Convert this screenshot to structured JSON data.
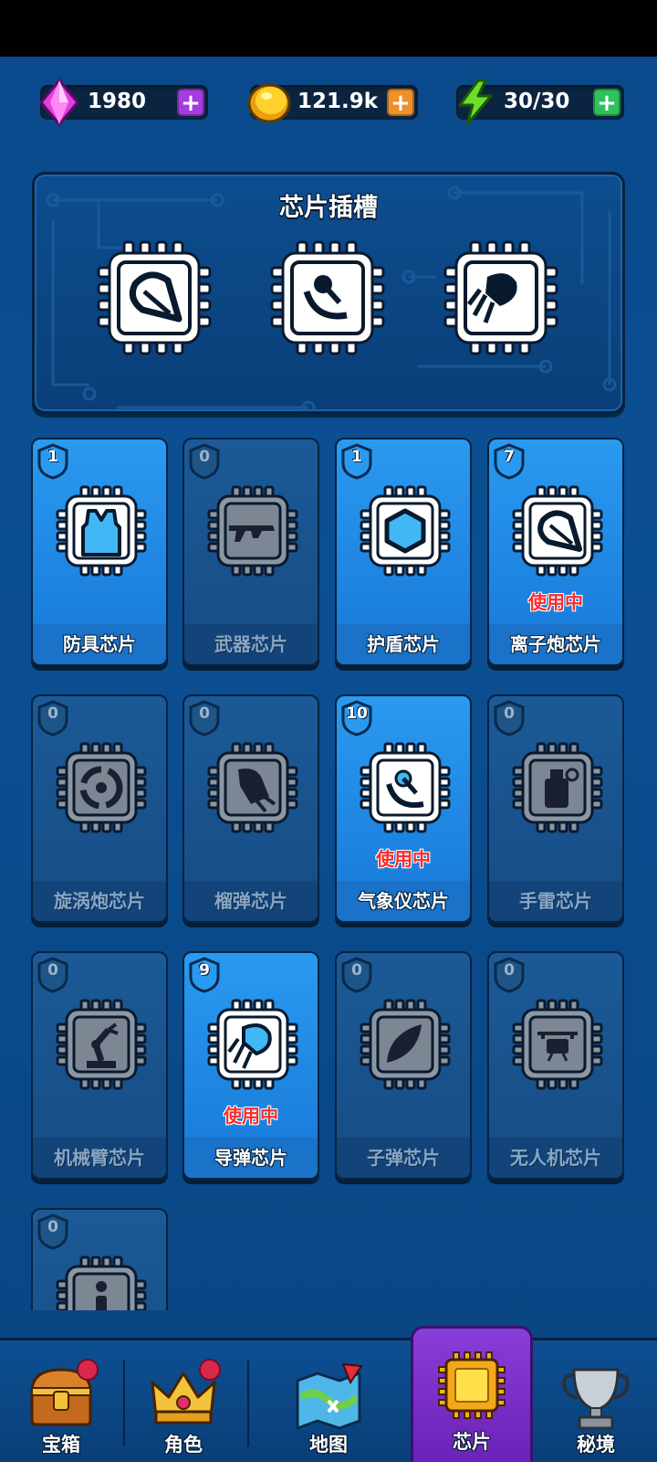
{
  "resources": [
    {
      "name": "gems",
      "value": "1980",
      "icon": "gem-icon",
      "plus_color": "#a63be0"
    },
    {
      "name": "coins",
      "value": "121.9k",
      "icon": "coin-icon",
      "plus_color": "#f0902a"
    },
    {
      "name": "energy",
      "value": "30/30",
      "icon": "lightning-icon",
      "plus_color": "#2ec25a"
    }
  ],
  "slot_panel": {
    "title": "芯片插槽",
    "slots": [
      "ion-cannon-chip-icon",
      "weather-chip-icon",
      "missile-chip-icon"
    ]
  },
  "cards": [
    {
      "level": "1",
      "label": "防具芯片",
      "active": true,
      "in_use": "",
      "icon": "vest-icon"
    },
    {
      "level": "0",
      "label": "武器芯片",
      "active": false,
      "in_use": "",
      "icon": "rifle-icon"
    },
    {
      "level": "1",
      "label": "护盾芯片",
      "active": true,
      "in_use": "",
      "icon": "hexagon-shield-icon"
    },
    {
      "level": "7",
      "label": "离子炮芯片",
      "active": true,
      "in_use": "使用中",
      "icon": "ion-cannon-icon"
    },
    {
      "level": "0",
      "label": "旋涡炮芯片",
      "active": false,
      "in_use": "",
      "icon": "vortex-icon"
    },
    {
      "level": "0",
      "label": "榴弹芯片",
      "active": false,
      "in_use": "",
      "icon": "grenade-launcher-icon"
    },
    {
      "level": "10",
      "label": "气象仪芯片",
      "active": true,
      "in_use": "使用中",
      "icon": "weather-probe-icon"
    },
    {
      "level": "0",
      "label": "手雷芯片",
      "active": false,
      "in_use": "",
      "icon": "hand-grenade-icon"
    },
    {
      "level": "0",
      "label": "机械臂芯片",
      "active": false,
      "in_use": "",
      "icon": "robot-arm-icon"
    },
    {
      "level": "9",
      "label": "导弹芯片",
      "active": true,
      "in_use": "使用中",
      "icon": "missile-icon"
    },
    {
      "level": "0",
      "label": "子弹芯片",
      "active": false,
      "in_use": "",
      "icon": "bullet-icon"
    },
    {
      "level": "0",
      "label": "无人机芯片",
      "active": false,
      "in_use": "",
      "icon": "drone-icon"
    },
    {
      "level": "0",
      "label": "",
      "active": false,
      "in_use": "",
      "icon": "info-icon"
    }
  ],
  "nav": [
    {
      "label": "宝箱",
      "icon": "treasure-chest-icon",
      "badge": true,
      "active": false
    },
    {
      "label": "角色",
      "icon": "crown-icon",
      "badge": true,
      "active": false
    },
    {
      "label": "地图",
      "icon": "map-icon",
      "badge": false,
      "active": false
    },
    {
      "label": "芯片",
      "icon": "chip-icon",
      "badge": false,
      "active": true
    },
    {
      "label": "秘境",
      "icon": "trophy-icon",
      "badge": false,
      "active": false
    }
  ]
}
